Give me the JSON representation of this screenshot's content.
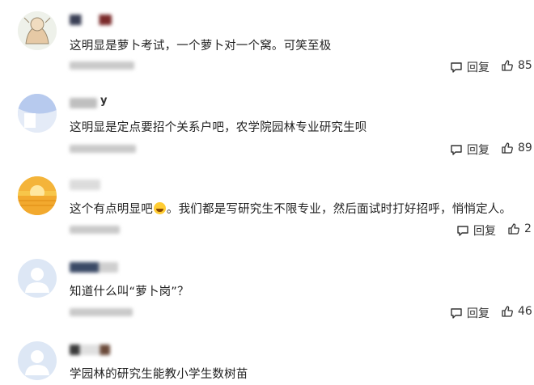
{
  "comments": [
    {
      "text": "这明显是萝卜考试，一个萝卜对一个窝。可笑至极",
      "reply_label": "回复",
      "likes": "85",
      "avatar": "sketch-avatar"
    },
    {
      "username_partial": "y",
      "text": "这明显是定点要招个关系户吧，农学院园林专业研究生呗",
      "reply_label": "回复",
      "likes": "89",
      "avatar": "blue-gradient-avatar"
    },
    {
      "text_before": "这个有点明显吧",
      "text_after": "。我们都是写研究生不限专业，然后面试时打好招呼，悄悄定人。",
      "emoji": "grinning-face-emoji",
      "reply_label": "回复",
      "likes": "2",
      "avatar": "sunset-avatar"
    },
    {
      "text": "知道什么叫“萝卜岗”？",
      "reply_label": "回复",
      "likes": "46",
      "avatar": "default-user-avatar"
    },
    {
      "text": "学园林的研究生能教小学生数树苗",
      "avatar": "default-user-avatar"
    }
  ],
  "colors": {
    "avatar_default_bg": "#dde7f5",
    "avatar_default_fg": "#ffffff"
  }
}
